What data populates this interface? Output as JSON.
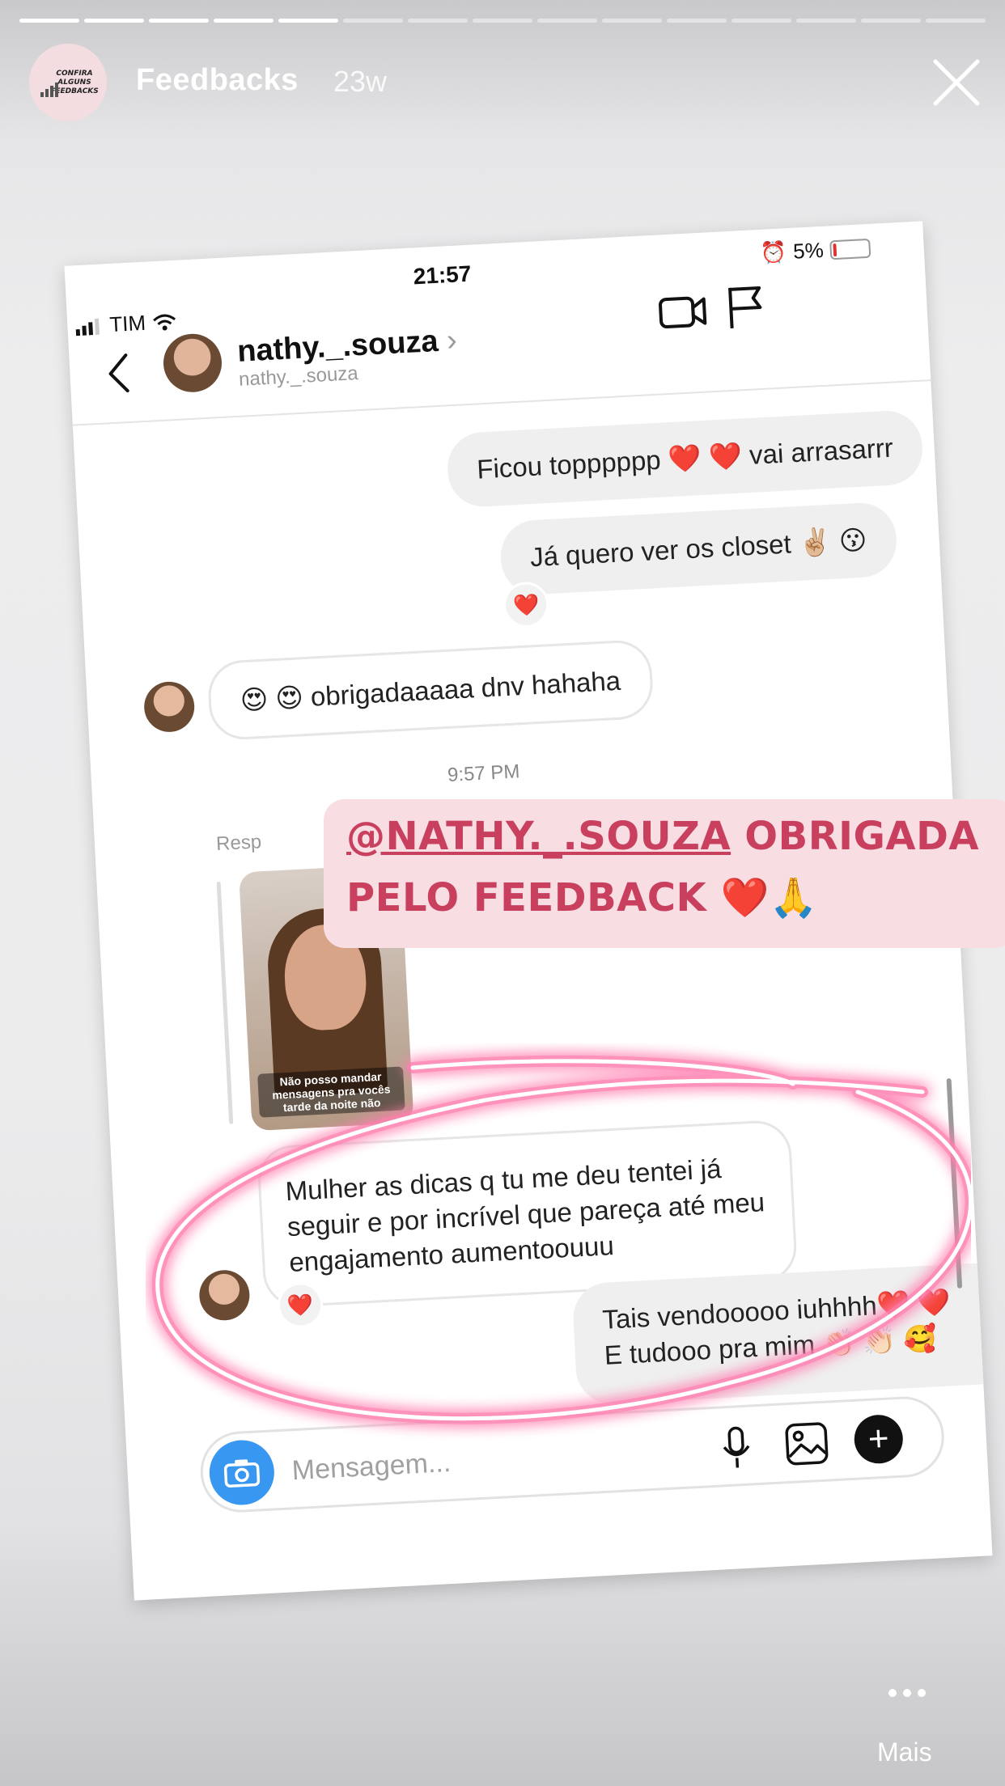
{
  "story": {
    "progress_total": 15,
    "progress_done": 5,
    "avatar_text": "CONFIRA ALGUNS FEEDBACKS",
    "title": "Feedbacks",
    "time": "23w",
    "more_label": "Mais"
  },
  "screenshot": {
    "status": {
      "time": "21:57",
      "carrier": "TIM",
      "battery": "5%"
    },
    "header": {
      "name": "nathy._.souza",
      "subname": "nathy._.souza"
    },
    "messages": [
      {
        "text": "Ficou topppppp ❤️ ❤️ vai arrasarrr",
        "side": "out"
      },
      {
        "text": "Já quero ver os closet ✌🏼 😗",
        "side": "out",
        "reaction": "❤️"
      },
      {
        "text": "😍 😍 obrigadaaaaa dnv hahaha",
        "side": "in"
      }
    ],
    "timestamp": "9:57 PM",
    "reply_label": "Resp",
    "story_reply_caption": "Não posso mandar mensagens pra vocês tarde da noite não",
    "long_message": "Mulher as dicas q tu me deu tentei já seguir e por incrível que pareça até meu engajamento aumentoouuu",
    "long_reaction": "❤️",
    "last_message_line1": "Tais vendooooo iuhhhh❤️ ❤️",
    "last_message_line2": "E tudooo pra mim 👏🏻 👏🏻 🥰",
    "compose_placeholder": "Mensagem..."
  },
  "overlay": {
    "mention_handle": "@NATHY._.SOUZA",
    "mention_line1_rest": " OBRIGADA",
    "mention_line2": "PELO FEEDBACK ❤️🙏",
    "accent": "#c8405e",
    "sticker_bg": "#f8dde3"
  }
}
